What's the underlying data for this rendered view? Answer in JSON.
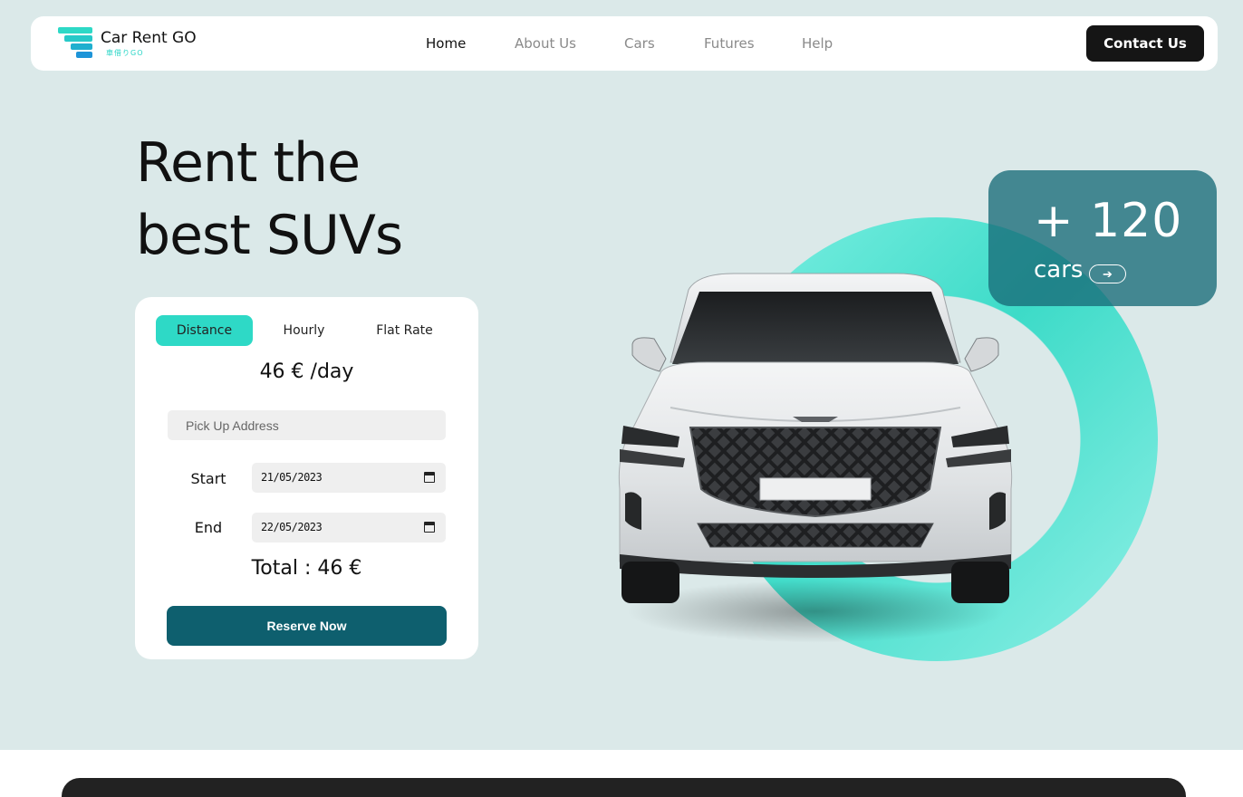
{
  "brand": {
    "name": "Car Rent GO",
    "tagline": "車借りGO",
    "colors": [
      "#2ed9c6",
      "#1fb7c8",
      "#1a9fd8",
      "#1e88d6"
    ]
  },
  "nav": {
    "links": [
      "Home",
      "About Us",
      "Cars",
      "Futures",
      "Help"
    ],
    "active": "Home",
    "contact_label": "Contact Us"
  },
  "hero": {
    "title_line1": "Rent the",
    "title_line2": "best SUVs"
  },
  "booking": {
    "tabs": [
      "Distance",
      "Hourly",
      "Flat Rate"
    ],
    "active_tab": "Distance",
    "price": "46 € /day",
    "address_placeholder": "Pick Up Address",
    "start_label": "Start",
    "start_value": "21/05/2023",
    "end_label": "End",
    "end_value": "22/05/2023",
    "total": "Total : 46 €",
    "reserve_label": "Reserve Now"
  },
  "stats": {
    "number": "+ 120",
    "label": "cars",
    "arrow": "➔"
  },
  "colors": {
    "background": "#dbe9e9",
    "accent": "#2ed9c6",
    "primary_button": "#0e5f6e",
    "stat_card": "#186c78",
    "dark": "#151515"
  }
}
